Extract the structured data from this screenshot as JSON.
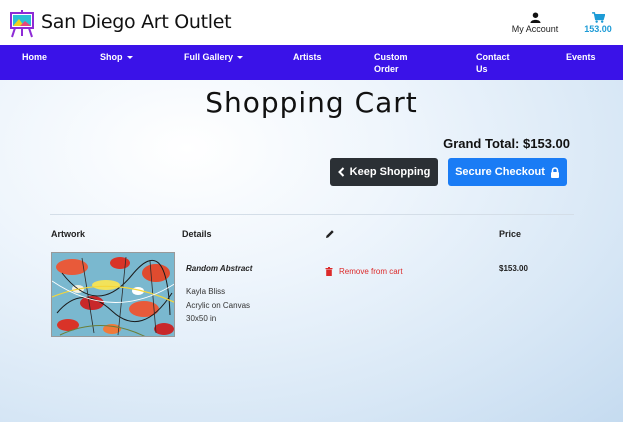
{
  "header": {
    "brand": "San Diego Art Outlet",
    "account_label": "My Account",
    "cart_total": "153.00"
  },
  "nav": {
    "items": [
      {
        "label": "Home"
      },
      {
        "label": "Shop"
      },
      {
        "label": "Full Gallery"
      },
      {
        "label": "Artists"
      },
      {
        "label": "Custom Order"
      },
      {
        "label": "Contact Us"
      },
      {
        "label": "Events"
      }
    ]
  },
  "page": {
    "title": "Shopping Cart",
    "grand_total": "Grand Total: $153.00",
    "keep_shopping": "Keep Shopping",
    "secure_checkout": "Secure Checkout"
  },
  "table": {
    "headers": {
      "artwork": "Artwork",
      "details": "Details",
      "price": "Price"
    },
    "rows": [
      {
        "title": "Random Abstract",
        "artist": "Kayla Bliss",
        "medium": "Acrylic on Canvas",
        "size": "30x50 in",
        "remove": "Remove from cart",
        "price": "$153.00"
      }
    ]
  },
  "colors": {
    "nav": "#3a12e8",
    "accent": "#1a7cf5",
    "dark_button": "#2b3035",
    "cart": "#1d9bd6",
    "remove": "#dc2a2a"
  }
}
